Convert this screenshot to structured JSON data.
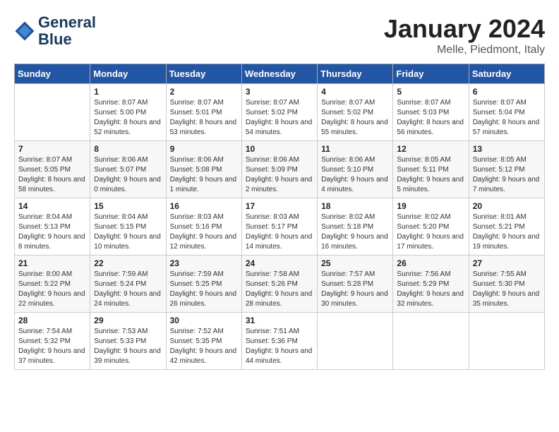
{
  "header": {
    "logo_line1": "General",
    "logo_line2": "Blue",
    "month": "January 2024",
    "location": "Melle, Piedmont, Italy"
  },
  "days_of_week": [
    "Sunday",
    "Monday",
    "Tuesday",
    "Wednesday",
    "Thursday",
    "Friday",
    "Saturday"
  ],
  "weeks": [
    [
      {
        "day": "",
        "sunrise": "",
        "sunset": "",
        "daylight": ""
      },
      {
        "day": "1",
        "sunrise": "Sunrise: 8:07 AM",
        "sunset": "Sunset: 5:00 PM",
        "daylight": "Daylight: 8 hours and 52 minutes."
      },
      {
        "day": "2",
        "sunrise": "Sunrise: 8:07 AM",
        "sunset": "Sunset: 5:01 PM",
        "daylight": "Daylight: 8 hours and 53 minutes."
      },
      {
        "day": "3",
        "sunrise": "Sunrise: 8:07 AM",
        "sunset": "Sunset: 5:02 PM",
        "daylight": "Daylight: 8 hours and 54 minutes."
      },
      {
        "day": "4",
        "sunrise": "Sunrise: 8:07 AM",
        "sunset": "Sunset: 5:02 PM",
        "daylight": "Daylight: 8 hours and 55 minutes."
      },
      {
        "day": "5",
        "sunrise": "Sunrise: 8:07 AM",
        "sunset": "Sunset: 5:03 PM",
        "daylight": "Daylight: 8 hours and 56 minutes."
      },
      {
        "day": "6",
        "sunrise": "Sunrise: 8:07 AM",
        "sunset": "Sunset: 5:04 PM",
        "daylight": "Daylight: 8 hours and 57 minutes."
      }
    ],
    [
      {
        "day": "7",
        "sunrise": "Sunrise: 8:07 AM",
        "sunset": "Sunset: 5:05 PM",
        "daylight": "Daylight: 8 hours and 58 minutes."
      },
      {
        "day": "8",
        "sunrise": "Sunrise: 8:06 AM",
        "sunset": "Sunset: 5:07 PM",
        "daylight": "Daylight: 9 hours and 0 minutes."
      },
      {
        "day": "9",
        "sunrise": "Sunrise: 8:06 AM",
        "sunset": "Sunset: 5:08 PM",
        "daylight": "Daylight: 9 hours and 1 minute."
      },
      {
        "day": "10",
        "sunrise": "Sunrise: 8:06 AM",
        "sunset": "Sunset: 5:09 PM",
        "daylight": "Daylight: 9 hours and 2 minutes."
      },
      {
        "day": "11",
        "sunrise": "Sunrise: 8:06 AM",
        "sunset": "Sunset: 5:10 PM",
        "daylight": "Daylight: 9 hours and 4 minutes."
      },
      {
        "day": "12",
        "sunrise": "Sunrise: 8:05 AM",
        "sunset": "Sunset: 5:11 PM",
        "daylight": "Daylight: 9 hours and 5 minutes."
      },
      {
        "day": "13",
        "sunrise": "Sunrise: 8:05 AM",
        "sunset": "Sunset: 5:12 PM",
        "daylight": "Daylight: 9 hours and 7 minutes."
      }
    ],
    [
      {
        "day": "14",
        "sunrise": "Sunrise: 8:04 AM",
        "sunset": "Sunset: 5:13 PM",
        "daylight": "Daylight: 9 hours and 8 minutes."
      },
      {
        "day": "15",
        "sunrise": "Sunrise: 8:04 AM",
        "sunset": "Sunset: 5:15 PM",
        "daylight": "Daylight: 9 hours and 10 minutes."
      },
      {
        "day": "16",
        "sunrise": "Sunrise: 8:03 AM",
        "sunset": "Sunset: 5:16 PM",
        "daylight": "Daylight: 9 hours and 12 minutes."
      },
      {
        "day": "17",
        "sunrise": "Sunrise: 8:03 AM",
        "sunset": "Sunset: 5:17 PM",
        "daylight": "Daylight: 9 hours and 14 minutes."
      },
      {
        "day": "18",
        "sunrise": "Sunrise: 8:02 AM",
        "sunset": "Sunset: 5:18 PM",
        "daylight": "Daylight: 9 hours and 16 minutes."
      },
      {
        "day": "19",
        "sunrise": "Sunrise: 8:02 AM",
        "sunset": "Sunset: 5:20 PM",
        "daylight": "Daylight: 9 hours and 17 minutes."
      },
      {
        "day": "20",
        "sunrise": "Sunrise: 8:01 AM",
        "sunset": "Sunset: 5:21 PM",
        "daylight": "Daylight: 9 hours and 19 minutes."
      }
    ],
    [
      {
        "day": "21",
        "sunrise": "Sunrise: 8:00 AM",
        "sunset": "Sunset: 5:22 PM",
        "daylight": "Daylight: 9 hours and 22 minutes."
      },
      {
        "day": "22",
        "sunrise": "Sunrise: 7:59 AM",
        "sunset": "Sunset: 5:24 PM",
        "daylight": "Daylight: 9 hours and 24 minutes."
      },
      {
        "day": "23",
        "sunrise": "Sunrise: 7:59 AM",
        "sunset": "Sunset: 5:25 PM",
        "daylight": "Daylight: 9 hours and 26 minutes."
      },
      {
        "day": "24",
        "sunrise": "Sunrise: 7:58 AM",
        "sunset": "Sunset: 5:26 PM",
        "daylight": "Daylight: 9 hours and 28 minutes."
      },
      {
        "day": "25",
        "sunrise": "Sunrise: 7:57 AM",
        "sunset": "Sunset: 5:28 PM",
        "daylight": "Daylight: 9 hours and 30 minutes."
      },
      {
        "day": "26",
        "sunrise": "Sunrise: 7:56 AM",
        "sunset": "Sunset: 5:29 PM",
        "daylight": "Daylight: 9 hours and 32 minutes."
      },
      {
        "day": "27",
        "sunrise": "Sunrise: 7:55 AM",
        "sunset": "Sunset: 5:30 PM",
        "daylight": "Daylight: 9 hours and 35 minutes."
      }
    ],
    [
      {
        "day": "28",
        "sunrise": "Sunrise: 7:54 AM",
        "sunset": "Sunset: 5:32 PM",
        "daylight": "Daylight: 9 hours and 37 minutes."
      },
      {
        "day": "29",
        "sunrise": "Sunrise: 7:53 AM",
        "sunset": "Sunset: 5:33 PM",
        "daylight": "Daylight: 9 hours and 39 minutes."
      },
      {
        "day": "30",
        "sunrise": "Sunrise: 7:52 AM",
        "sunset": "Sunset: 5:35 PM",
        "daylight": "Daylight: 9 hours and 42 minutes."
      },
      {
        "day": "31",
        "sunrise": "Sunrise: 7:51 AM",
        "sunset": "Sunset: 5:36 PM",
        "daylight": "Daylight: 9 hours and 44 minutes."
      },
      {
        "day": "",
        "sunrise": "",
        "sunset": "",
        "daylight": ""
      },
      {
        "day": "",
        "sunrise": "",
        "sunset": "",
        "daylight": ""
      },
      {
        "day": "",
        "sunrise": "",
        "sunset": "",
        "daylight": ""
      }
    ]
  ]
}
